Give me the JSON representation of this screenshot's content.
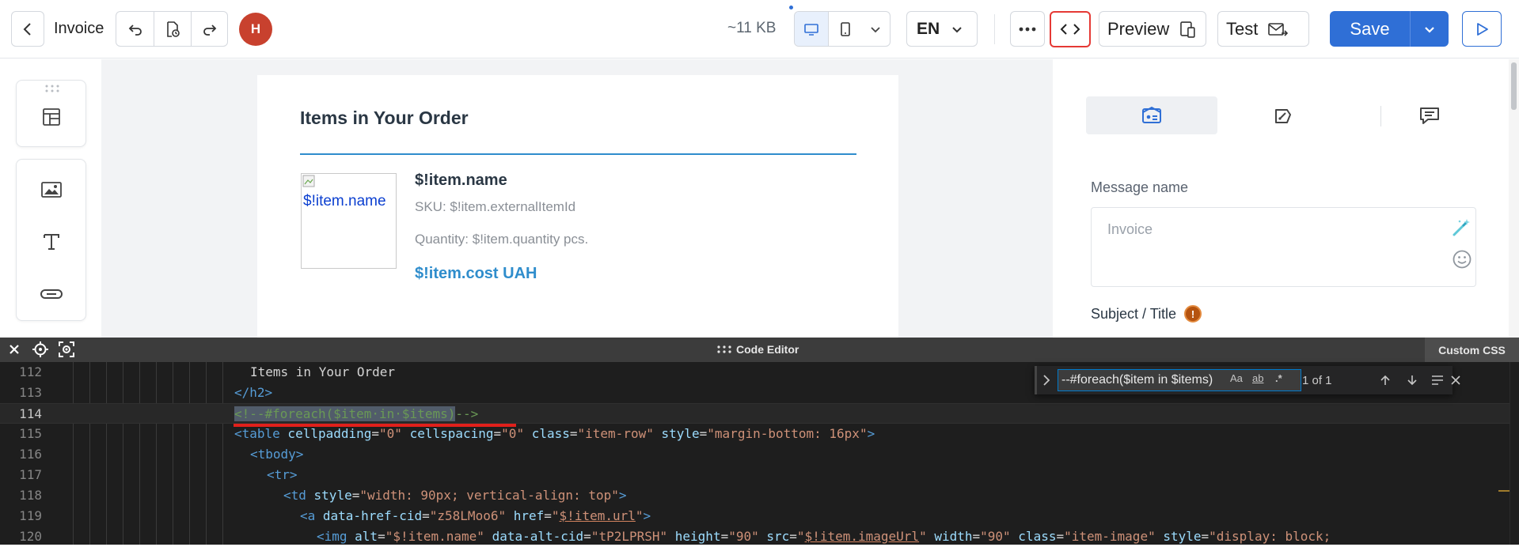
{
  "topbar": {
    "title": "Invoice",
    "avatar_initial": "H",
    "size_text": "~11 KB",
    "language": "EN",
    "preview_label": "Preview",
    "test_label": "Test",
    "save_label": "Save",
    "colors": {
      "accent": "#2f6fd6",
      "avatar": "#c8412e",
      "highlight": "#e53935"
    }
  },
  "canvas": {
    "heading": "Items in Your Order",
    "image_alt": "$!item.name",
    "item_name": "$!item.name",
    "item_sku": "SKU: $!item.externalItemId",
    "item_quantity": "Quantity: $!item.quantity pcs.",
    "item_cost": "$!item.cost UAH"
  },
  "right_panel": {
    "message_name_label": "Message name",
    "message_name_placeholder": "Invoice",
    "subject_label": "Subject / Title",
    "warning_glyph": "!"
  },
  "code_editor": {
    "title": "Code Editor",
    "custom_css_label": "Custom CSS",
    "find": {
      "query": "--#foreach($item in $items)",
      "match_case": "Aa",
      "whole_word": "ab",
      "regex": ".*",
      "result_count": "1 of 1"
    },
    "lines": [
      {
        "no": "112",
        "text": "Items in Your Order"
      },
      {
        "no": "113",
        "text": "</h2>"
      },
      {
        "no": "114",
        "text": "<!--#foreach($item·in·$items)-->"
      },
      {
        "no": "115",
        "text": "<table cellpadding=\"0\" cellspacing=\"0\" class=\"item-row\" style=\"margin-bottom: 16px\">"
      },
      {
        "no": "116",
        "text": "<tbody>"
      },
      {
        "no": "117",
        "text": "<tr>"
      },
      {
        "no": "118",
        "text": "<td style=\"width: 90px; vertical-align: top\">"
      },
      {
        "no": "119",
        "text": "<a data-href-cid=\"z58LMoo6\" href=\"$!item.url\">"
      },
      {
        "no": "120",
        "text": "<img alt=\"$!item.name\" data-alt-cid=\"tP2LPRSH\" height=\"90\" src=\"$!item.imageUrl\" width=\"90\" class=\"item-image\" style=\"display: block;"
      }
    ],
    "tokens": {
      "l112": "Items in Your Order",
      "l113_tag": "</h2>",
      "l114_match": "<!--#foreach($item·in·$items)",
      "l114_end": "-->",
      "l115": {
        "open": "<table",
        "a1": " cellpadding",
        "eq": "=",
        "v1": "\"0\"",
        "a2": " cellspacing",
        "v2": "\"0\"",
        "a3": " class",
        "v3": "\"item-row\"",
        "a4": " style",
        "v4": "\"margin-bottom: 16px\"",
        "close": ">"
      },
      "l116": "<tbody>",
      "l117": "<tr>",
      "l118": {
        "open": "<td",
        "a1": " style",
        "v1": "\"width: 90px; vertical-align: top\"",
        "close": ">"
      },
      "l119": {
        "open": "<a",
        "a1": " data-href-cid",
        "v1": "\"z58LMoo6\"",
        "a2": " href",
        "q": "\"",
        "v2": "$!item.url",
        "close": ">"
      },
      "l120": {
        "open": "<img",
        "a1": " alt",
        "v1": "\"$!item.name\"",
        "a2": " data-alt-cid",
        "v2": "\"tP2LPRSH\"",
        "a3": " height",
        "v3": "\"90\"",
        "a4": " src",
        "v4": "$!item.imageUrl",
        "a5": " width",
        "v5": "\"90\"",
        "a6": " class",
        "v6": "\"item-image\"",
        "a7": " style",
        "v7": "\"display: block;"
      }
    }
  }
}
